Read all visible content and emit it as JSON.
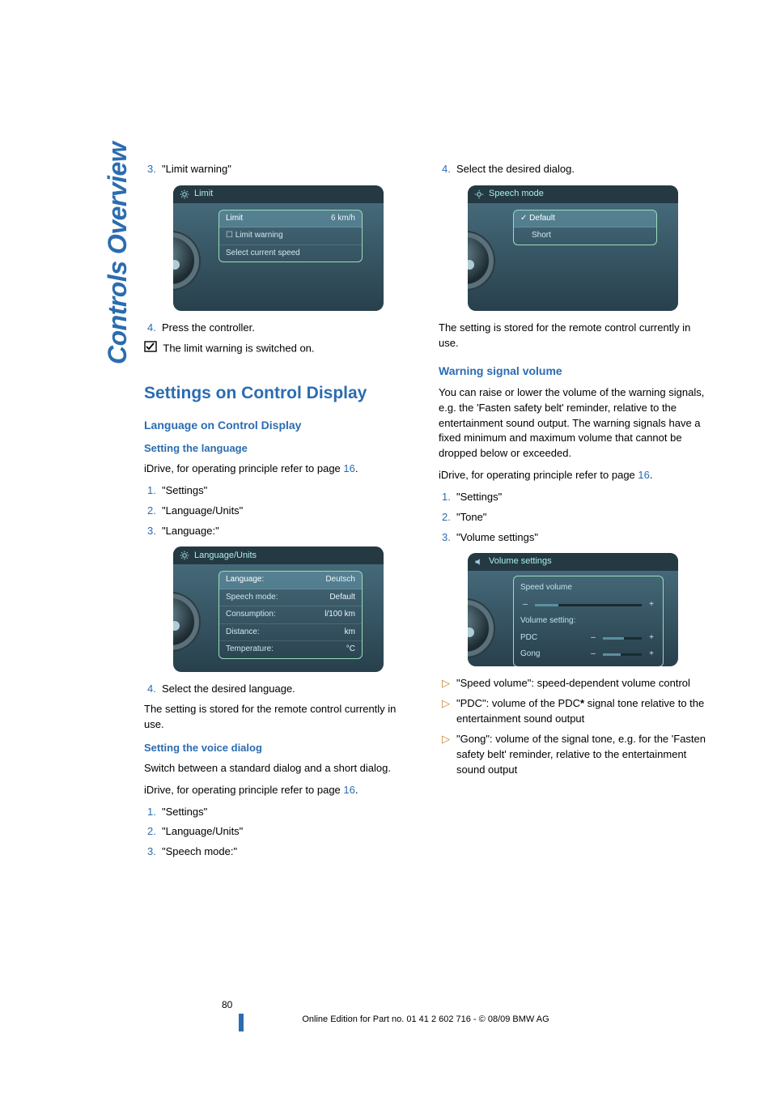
{
  "sidebar_label": "Controls Overview",
  "page_number": "80",
  "footer": "Online Edition for Part no. 01 41 2 602 716 - © 08/09 BMW AG",
  "left": {
    "step3_num": "3.",
    "step3_text": "\"Limit warning\"",
    "fig1": {
      "header": "Limit",
      "rows": [
        {
          "k": "Limit",
          "v": "6 km/h",
          "sel": true
        },
        {
          "k": "Limit warning",
          "v": "",
          "chk": true
        },
        {
          "k": "Select current speed",
          "v": ""
        }
      ]
    },
    "step4_num": "4.",
    "step4_text": "Press the controller.",
    "check_text": "The limit warning is switched on.",
    "h1": "Settings on Control Display",
    "h2a": "Language on Control Display",
    "h3a": "Setting the language",
    "idrive1": "iDrive, for operating principle refer to page ",
    "idrive1_link": "16",
    "idrive1_end": ".",
    "lang_steps_num": [
      "1.",
      "2.",
      "3."
    ],
    "lang_steps": [
      "\"Settings\"",
      "\"Language/Units\"",
      "\"Language:\""
    ],
    "fig2": {
      "header": "Language/Units",
      "rows": [
        {
          "k": "Language:",
          "v": "Deutsch",
          "sel": true
        },
        {
          "k": "Speech mode:",
          "v": "Default"
        },
        {
          "k": "Consumption:",
          "v": "l/100 km"
        },
        {
          "k": "Distance:",
          "v": "km"
        },
        {
          "k": "Temperature:",
          "v": "°C"
        }
      ]
    },
    "lang_step4_num": "4.",
    "lang_step4_text": "Select the desired language.",
    "stored_remote": "The setting is stored for the remote control currently in use.",
    "h3b": "Setting the voice dialog",
    "voice_desc": "Switch between a standard dialog and a short dialog.",
    "idrive2": "iDrive, for operating principle refer to page ",
    "idrive2_link": "16",
    "idrive2_end": ".",
    "voice_steps_num": [
      "1.",
      "2.",
      "3."
    ],
    "voice_steps": [
      "\"Settings\"",
      "\"Language/Units\"",
      "\"Speech mode:\""
    ]
  },
  "right": {
    "step4_num": "4.",
    "step4_text": "Select the desired dialog.",
    "fig3": {
      "header": "Speech mode",
      "rows": [
        {
          "k": "Default",
          "chk": true,
          "sel": true
        },
        {
          "k": "Short"
        }
      ]
    },
    "stored_remote": "The setting is stored for the remote control currently in use.",
    "h2b": "Warning signal volume",
    "warn_desc": "You can raise or lower the volume of the warning signals, e.g. the 'Fasten safety belt' reminder, relative to the entertainment sound output. The warning signals have a fixed minimum and maximum volume that cannot be dropped below or exceeded.",
    "idrive3": "iDrive, for operating principle refer to page ",
    "idrive3_link": "16",
    "idrive3_end": ".",
    "vol_steps_num": [
      "1.",
      "2.",
      "3."
    ],
    "vol_steps": [
      "\"Settings\"",
      "\"Tone\"",
      "\"Volume settings\""
    ],
    "fig4": {
      "header": "Volume settings",
      "speed_label": "Speed volume",
      "speed_fill": "22%",
      "setting_label": "Volume setting:",
      "pdc_label": "PDC",
      "pdc_fill": "55%",
      "gong_label": "Gong",
      "gong_fill": "45%"
    },
    "bullets": [
      "\"Speed volume\": speed-dependent volume control",
      "\"PDC\": volume of the PDC* signal tone relative to the entertainment sound output",
      "\"Gong\": volume of the signal tone, e.g. for the 'Fasten safety belt' reminder, relative to the entertainment sound output"
    ],
    "bullets_formatted": {
      "b2_pre": "\"PDC\": volume of the PDC",
      "b2_star": "*",
      "b2_post": " signal tone relative to the entertainment sound output"
    }
  }
}
